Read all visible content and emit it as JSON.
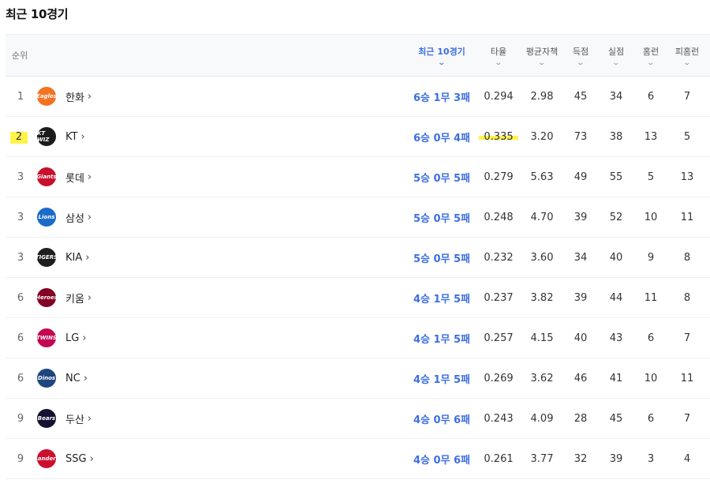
{
  "page": {
    "title": "최근 10경기"
  },
  "columns": {
    "rank": "순위",
    "recent10": "최근 10경기",
    "avg": "타율",
    "era": "평균자책",
    "runs": "득점",
    "allowed": "실점",
    "hr": "홈런",
    "hr_allowed": "피홈런",
    "chevron": "⌄"
  },
  "accent_color": "#3d6fe0",
  "highlight_color": "#fff34a",
  "rows": [
    {
      "rank": "1",
      "team": "한화",
      "logo": "Eagles",
      "logo_color": "#f37321",
      "record": "6승 1무 3패",
      "avg": "0.294",
      "era": "2.98",
      "runs": "45",
      "allowed": "34",
      "hr": "6",
      "hr_allowed": "7"
    },
    {
      "rank": "2",
      "team": "KT",
      "logo": "KT WIZ",
      "logo_color": "#1b1b1b",
      "record": "6승 0무 4패",
      "avg": "0.335",
      "era": "3.20",
      "runs": "73",
      "allowed": "38",
      "hr": "13",
      "hr_allowed": "5"
    },
    {
      "rank": "3",
      "team": "롯데",
      "logo": "Giants",
      "logo_color": "#c8102e",
      "record": "5승 0무 5패",
      "avg": "0.279",
      "era": "5.63",
      "runs": "49",
      "allowed": "55",
      "hr": "5",
      "hr_allowed": "13"
    },
    {
      "rank": "3",
      "team": "삼성",
      "logo": "Lions",
      "logo_color": "#1b6cc8",
      "record": "5승 0무 5패",
      "avg": "0.248",
      "era": "4.70",
      "runs": "39",
      "allowed": "52",
      "hr": "10",
      "hr_allowed": "11"
    },
    {
      "rank": "3",
      "team": "KIA",
      "logo": "TIGERS",
      "logo_color": "#1e1e1e",
      "record": "5승 0무 5패",
      "avg": "0.232",
      "era": "3.60",
      "runs": "34",
      "allowed": "40",
      "hr": "9",
      "hr_allowed": "8"
    },
    {
      "rank": "6",
      "team": "키움",
      "logo": "Heroes",
      "logo_color": "#820024",
      "record": "4승 1무 5패",
      "avg": "0.237",
      "era": "3.82",
      "runs": "39",
      "allowed": "44",
      "hr": "11",
      "hr_allowed": "8"
    },
    {
      "rank": "6",
      "team": "LG",
      "logo": "TWINS",
      "logo_color": "#c30452",
      "record": "4승 1무 5패",
      "avg": "0.257",
      "era": "4.15",
      "runs": "40",
      "allowed": "43",
      "hr": "6",
      "hr_allowed": "7"
    },
    {
      "rank": "6",
      "team": "NC",
      "logo": "Dinos",
      "logo_color": "#1d467d",
      "record": "4승 1무 5패",
      "avg": "0.269",
      "era": "3.62",
      "runs": "46",
      "allowed": "41",
      "hr": "10",
      "hr_allowed": "11"
    },
    {
      "rank": "9",
      "team": "두산",
      "logo": "Bears",
      "logo_color": "#131230",
      "record": "4승 0무 6패",
      "avg": "0.243",
      "era": "4.09",
      "runs": "28",
      "allowed": "45",
      "hr": "6",
      "hr_allowed": "7"
    },
    {
      "rank": "9",
      "team": "SSG",
      "logo": "Landers",
      "logo_color": "#ce0e2d",
      "record": "4승 0무 6패",
      "avg": "0.261",
      "era": "3.77",
      "runs": "32",
      "allowed": "39",
      "hr": "3",
      "hr_allowed": "4"
    }
  ]
}
